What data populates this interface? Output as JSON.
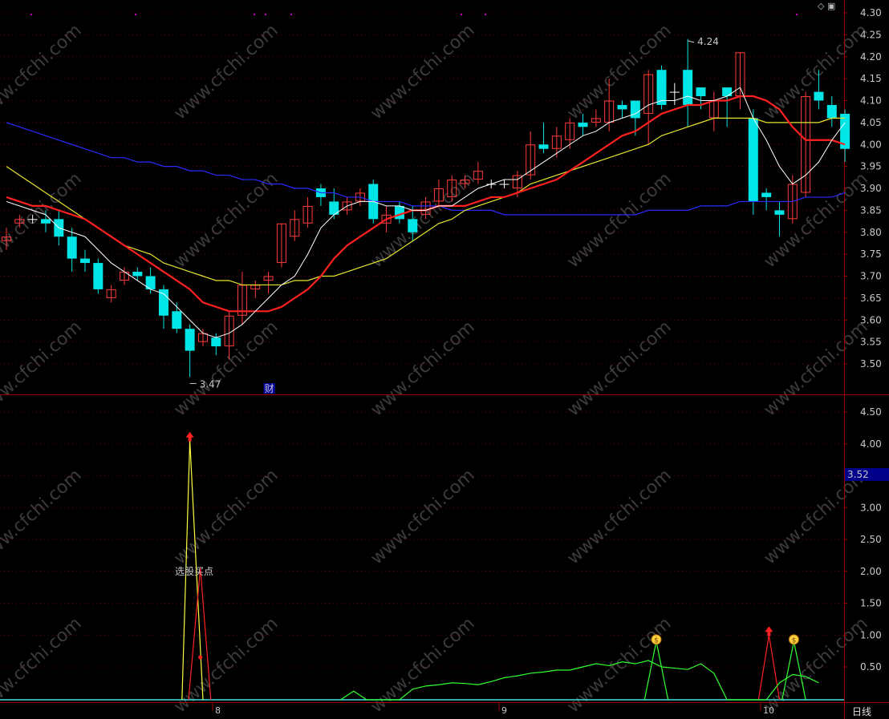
{
  "chart_data": [
    {
      "type": "candlestick",
      "yticks": [
        "4.30",
        "4.25",
        "4.20",
        "4.15",
        "4.10",
        "4.05",
        "4.00",
        "3.95",
        "3.90",
        "3.85",
        "3.80",
        "3.75",
        "3.70",
        "3.65",
        "3.60",
        "3.55",
        "3.50"
      ],
      "ylim": [
        3.45,
        4.32
      ],
      "candles": [
        [
          3.78,
          3.79,
          3.76,
          3.81
        ],
        [
          3.82,
          3.83,
          3.81,
          3.84
        ],
        [
          3.83,
          3.83,
          3.82,
          3.84
        ],
        [
          3.83,
          3.82,
          3.8,
          3.85
        ],
        [
          3.83,
          3.79,
          3.77,
          3.85
        ],
        [
          3.79,
          3.74,
          3.71,
          3.81
        ],
        [
          3.74,
          3.73,
          3.71,
          3.76
        ],
        [
          3.73,
          3.67,
          3.66,
          3.74
        ],
        [
          3.65,
          3.67,
          3.64,
          3.68
        ],
        [
          3.69,
          3.71,
          3.68,
          3.72
        ],
        [
          3.71,
          3.7,
          3.69,
          3.72
        ],
        [
          3.7,
          3.67,
          3.66,
          3.72
        ],
        [
          3.67,
          3.61,
          3.58,
          3.68
        ],
        [
          3.62,
          3.58,
          3.57,
          3.64
        ],
        [
          3.58,
          3.53,
          3.47,
          3.59
        ],
        [
          3.55,
          3.57,
          3.54,
          3.58
        ],
        [
          3.56,
          3.54,
          3.52,
          3.57
        ],
        [
          3.54,
          3.61,
          3.51,
          3.62
        ],
        [
          3.61,
          3.68,
          3.59,
          3.71
        ],
        [
          3.67,
          3.68,
          3.65,
          3.69
        ],
        [
          3.69,
          3.7,
          3.66,
          3.71
        ],
        [
          3.73,
          3.82,
          3.72,
          3.82
        ],
        [
          3.79,
          3.83,
          3.78,
          3.85
        ],
        [
          3.82,
          3.86,
          3.81,
          3.88
        ],
        [
          3.9,
          3.88,
          3.86,
          3.91
        ],
        [
          3.87,
          3.84,
          3.83,
          3.9
        ],
        [
          3.85,
          3.87,
          3.84,
          3.88
        ],
        [
          3.87,
          3.89,
          3.86,
          3.9
        ],
        [
          3.91,
          3.83,
          3.82,
          3.92
        ],
        [
          3.82,
          3.84,
          3.8,
          3.86
        ],
        [
          3.86,
          3.83,
          3.82,
          3.87
        ],
        [
          3.83,
          3.8,
          3.78,
          3.86
        ],
        [
          3.84,
          3.87,
          3.83,
          3.88
        ],
        [
          3.87,
          3.9,
          3.86,
          3.92
        ],
        [
          3.88,
          3.92,
          3.87,
          3.93
        ],
        [
          3.91,
          3.92,
          3.9,
          3.93
        ],
        [
          3.92,
          3.94,
          3.91,
          3.96
        ],
        [
          3.91,
          3.91,
          3.9,
          3.92
        ],
        [
          3.91,
          3.91,
          3.9,
          3.92
        ],
        [
          3.9,
          3.93,
          3.88,
          3.94
        ],
        [
          3.93,
          4.0,
          3.92,
          4.03
        ],
        [
          4.0,
          3.99,
          3.98,
          4.05
        ],
        [
          3.99,
          4.02,
          3.97,
          4.04
        ],
        [
          4.01,
          4.05,
          3.99,
          4.06
        ],
        [
          4.05,
          4.04,
          4.02,
          4.07
        ],
        [
          4.05,
          4.06,
          4.04,
          4.08
        ],
        [
          4.05,
          4.1,
          4.03,
          4.15
        ],
        [
          4.09,
          4.08,
          4.06,
          4.1
        ],
        [
          4.1,
          4.06,
          4.02,
          4.1
        ],
        [
          4.07,
          4.16,
          4.0,
          4.17
        ],
        [
          4.17,
          4.09,
          4.08,
          4.18
        ],
        [
          4.12,
          4.12,
          4.09,
          4.14
        ],
        [
          4.17,
          4.09,
          4.04,
          4.24
        ],
        [
          4.13,
          4.11,
          4.08,
          4.13
        ],
        [
          4.06,
          4.1,
          4.03,
          4.12
        ],
        [
          4.13,
          4.11,
          4.04,
          4.13
        ],
        [
          4.11,
          4.21,
          4.08,
          4.21
        ],
        [
          4.06,
          3.87,
          3.84,
          4.08
        ],
        [
          3.89,
          3.88,
          3.85,
          3.9
        ],
        [
          3.85,
          3.84,
          3.79,
          3.87
        ],
        [
          3.83,
          3.91,
          3.82,
          3.93
        ],
        [
          3.89,
          4.11,
          3.88,
          4.12
        ],
        [
          4.12,
          4.1,
          4.08,
          4.17
        ],
        [
          4.09,
          4.06,
          4.04,
          4.11
        ],
        [
          4.07,
          3.99,
          3.96,
          4.08
        ]
      ],
      "ma5": [
        3.87,
        3.86,
        3.85,
        3.84,
        3.81,
        3.8,
        3.79,
        3.76,
        3.73,
        3.71,
        3.69,
        3.67,
        3.66,
        3.63,
        3.6,
        3.57,
        3.56,
        3.57,
        3.59,
        3.62,
        3.65,
        3.68,
        3.7,
        3.75,
        3.81,
        3.84,
        3.86,
        3.87,
        3.87,
        3.86,
        3.86,
        3.85,
        3.85,
        3.86,
        3.86,
        3.88,
        3.9,
        3.91,
        3.92,
        3.92,
        3.94,
        3.96,
        3.98,
        4.0,
        4.02,
        4.03,
        4.05,
        4.06,
        4.07,
        4.09,
        4.1,
        4.1,
        4.11,
        4.1,
        4.1,
        4.11,
        4.13,
        4.06,
        4.01,
        3.95,
        3.91,
        3.93,
        3.96,
        4.01,
        4.05
      ],
      "ma10": [
        3.88,
        3.87,
        3.86,
        3.86,
        3.85,
        3.84,
        3.83,
        3.81,
        3.79,
        3.77,
        3.75,
        3.73,
        3.71,
        3.69,
        3.67,
        3.64,
        3.63,
        3.62,
        3.62,
        3.62,
        3.62,
        3.63,
        3.65,
        3.67,
        3.7,
        3.74,
        3.77,
        3.79,
        3.81,
        3.83,
        3.84,
        3.85,
        3.85,
        3.86,
        3.86,
        3.86,
        3.87,
        3.88,
        3.88,
        3.89,
        3.9,
        3.91,
        3.92,
        3.94,
        3.96,
        3.98,
        4.0,
        4.02,
        4.03,
        4.05,
        4.07,
        4.08,
        4.09,
        4.09,
        4.1,
        4.1,
        4.11,
        4.11,
        4.1,
        4.08,
        4.04,
        4.01,
        4.01,
        4.01,
        4.0
      ],
      "ma30": [
        3.95,
        3.93,
        3.91,
        3.89,
        3.87,
        3.85,
        3.83,
        3.81,
        3.79,
        3.77,
        3.76,
        3.75,
        3.73,
        3.72,
        3.71,
        3.7,
        3.69,
        3.69,
        3.68,
        3.68,
        3.68,
        3.68,
        3.69,
        3.69,
        3.7,
        3.7,
        3.71,
        3.72,
        3.73,
        3.74,
        3.76,
        3.78,
        3.8,
        3.82,
        3.83,
        3.85,
        3.86,
        3.87,
        3.88,
        3.89,
        3.91,
        3.92,
        3.93,
        3.94,
        3.95,
        3.96,
        3.97,
        3.98,
        3.99,
        4.0,
        4.02,
        4.03,
        4.04,
        4.05,
        4.06,
        4.06,
        4.06,
        4.06,
        4.05,
        4.05,
        4.05,
        4.05,
        4.05,
        4.06,
        4.06
      ],
      "ma60": [
        4.05,
        4.04,
        4.03,
        4.02,
        4.01,
        4.0,
        3.99,
        3.98,
        3.97,
        3.97,
        3.96,
        3.96,
        3.95,
        3.95,
        3.94,
        3.94,
        3.93,
        3.93,
        3.92,
        3.92,
        3.91,
        3.91,
        3.9,
        3.9,
        3.89,
        3.89,
        3.88,
        3.88,
        3.87,
        3.87,
        3.87,
        3.86,
        3.86,
        3.86,
        3.85,
        3.85,
        3.85,
        3.85,
        3.84,
        3.84,
        3.84,
        3.84,
        3.84,
        3.84,
        3.84,
        3.84,
        3.84,
        3.84,
        3.84,
        3.85,
        3.85,
        3.85,
        3.85,
        3.86,
        3.86,
        3.86,
        3.87,
        3.87,
        3.87,
        3.87,
        3.87,
        3.88,
        3.88,
        3.88,
        3.89
      ],
      "annotations": [
        {
          "text": "4.24",
          "index": 52
        },
        {
          "text": "3.47",
          "index": 14
        }
      ],
      "marker_label": "财",
      "colors": {
        "up": "#ff3b3b",
        "down": "#00e5e5",
        "ma5": "#ffffff",
        "ma10": "#ff2020",
        "ma30": "#e6e62e",
        "ma60": "#2a2aff"
      }
    },
    {
      "type": "line",
      "yticks": [
        "4.50",
        "4.00",
        "3.50",
        "3.00",
        "2.50",
        "2.00",
        "1.50",
        "1.00",
        "0.50"
      ],
      "ylim": [
        0,
        4.75
      ],
      "current_value": "3.52",
      "series": [
        {
          "color": "#ffff40",
          "points": [
            [
              13.4,
              0
            ],
            [
              14,
              4.05
            ],
            [
              15,
              0
            ]
          ]
        },
        {
          "color": "#ff2020",
          "points": [
            [
              13.9,
              0
            ],
            [
              14.8,
              2.05
            ],
            [
              15.6,
              0
            ]
          ]
        },
        {
          "color": "#ff2020",
          "points": [
            [
              57.4,
              0
            ],
            [
              58.2,
              1.0
            ],
            [
              59.0,
              0
            ]
          ]
        },
        {
          "color": "#30ff30",
          "points": [
            [
              48.7,
              0
            ],
            [
              49.6,
              0.9
            ],
            [
              50.5,
              0
            ]
          ]
        },
        {
          "color": "#30ff30",
          "points": [
            [
              59.2,
              0
            ],
            [
              60.1,
              0.9
            ],
            [
              61.0,
              0
            ]
          ]
        },
        {
          "color": "#30ff30",
          "points": [
            [
              25.5,
              0
            ],
            [
              26.5,
              0.12
            ],
            [
              27.5,
              0
            ],
            [
              30,
              0
            ],
            [
              31,
              0.15
            ],
            [
              32,
              0.2
            ],
            [
              33,
              0.22
            ],
            [
              34,
              0.25
            ],
            [
              35,
              0.24
            ],
            [
              36,
              0.22
            ],
            [
              37,
              0.27
            ],
            [
              38,
              0.33
            ],
            [
              39,
              0.36
            ],
            [
              40,
              0.4
            ],
            [
              41,
              0.42
            ],
            [
              42,
              0.45
            ],
            [
              43,
              0.45
            ],
            [
              44,
              0.5
            ],
            [
              45,
              0.55
            ],
            [
              46,
              0.52
            ],
            [
              47,
              0.58
            ],
            [
              48,
              0.55
            ],
            [
              49,
              0.6
            ],
            [
              50,
              0.5
            ],
            [
              51,
              0.48
            ],
            [
              52,
              0.46
            ],
            [
              53,
              0.55
            ],
            [
              54,
              0.4
            ],
            [
              55,
              0
            ],
            [
              58,
              0
            ],
            [
              59,
              0.25
            ],
            [
              60,
              0.38
            ],
            [
              61,
              0.35
            ],
            [
              62,
              0.25
            ]
          ]
        }
      ],
      "markers": [
        {
          "type": "up-arrow",
          "color": "#ff2020",
          "index": 14,
          "value": 4.1
        },
        {
          "type": "up-arrow",
          "color": "#ff2020",
          "index": 58.2,
          "value": 1.05
        },
        {
          "type": "money-bag",
          "index": 49.6,
          "value": 0.93
        },
        {
          "type": "money-bag",
          "index": 60.1,
          "value": 0.93
        },
        {
          "type": "dot",
          "color": "#ff2020",
          "index": 14.8,
          "value": 0.65
        }
      ],
      "label": "选股买点"
    }
  ],
  "x_ticks": [
    "8",
    "9",
    "10"
  ],
  "period_label": "日线",
  "watermark": "www.cfchi.com",
  "top_icons": "◇ ▣"
}
